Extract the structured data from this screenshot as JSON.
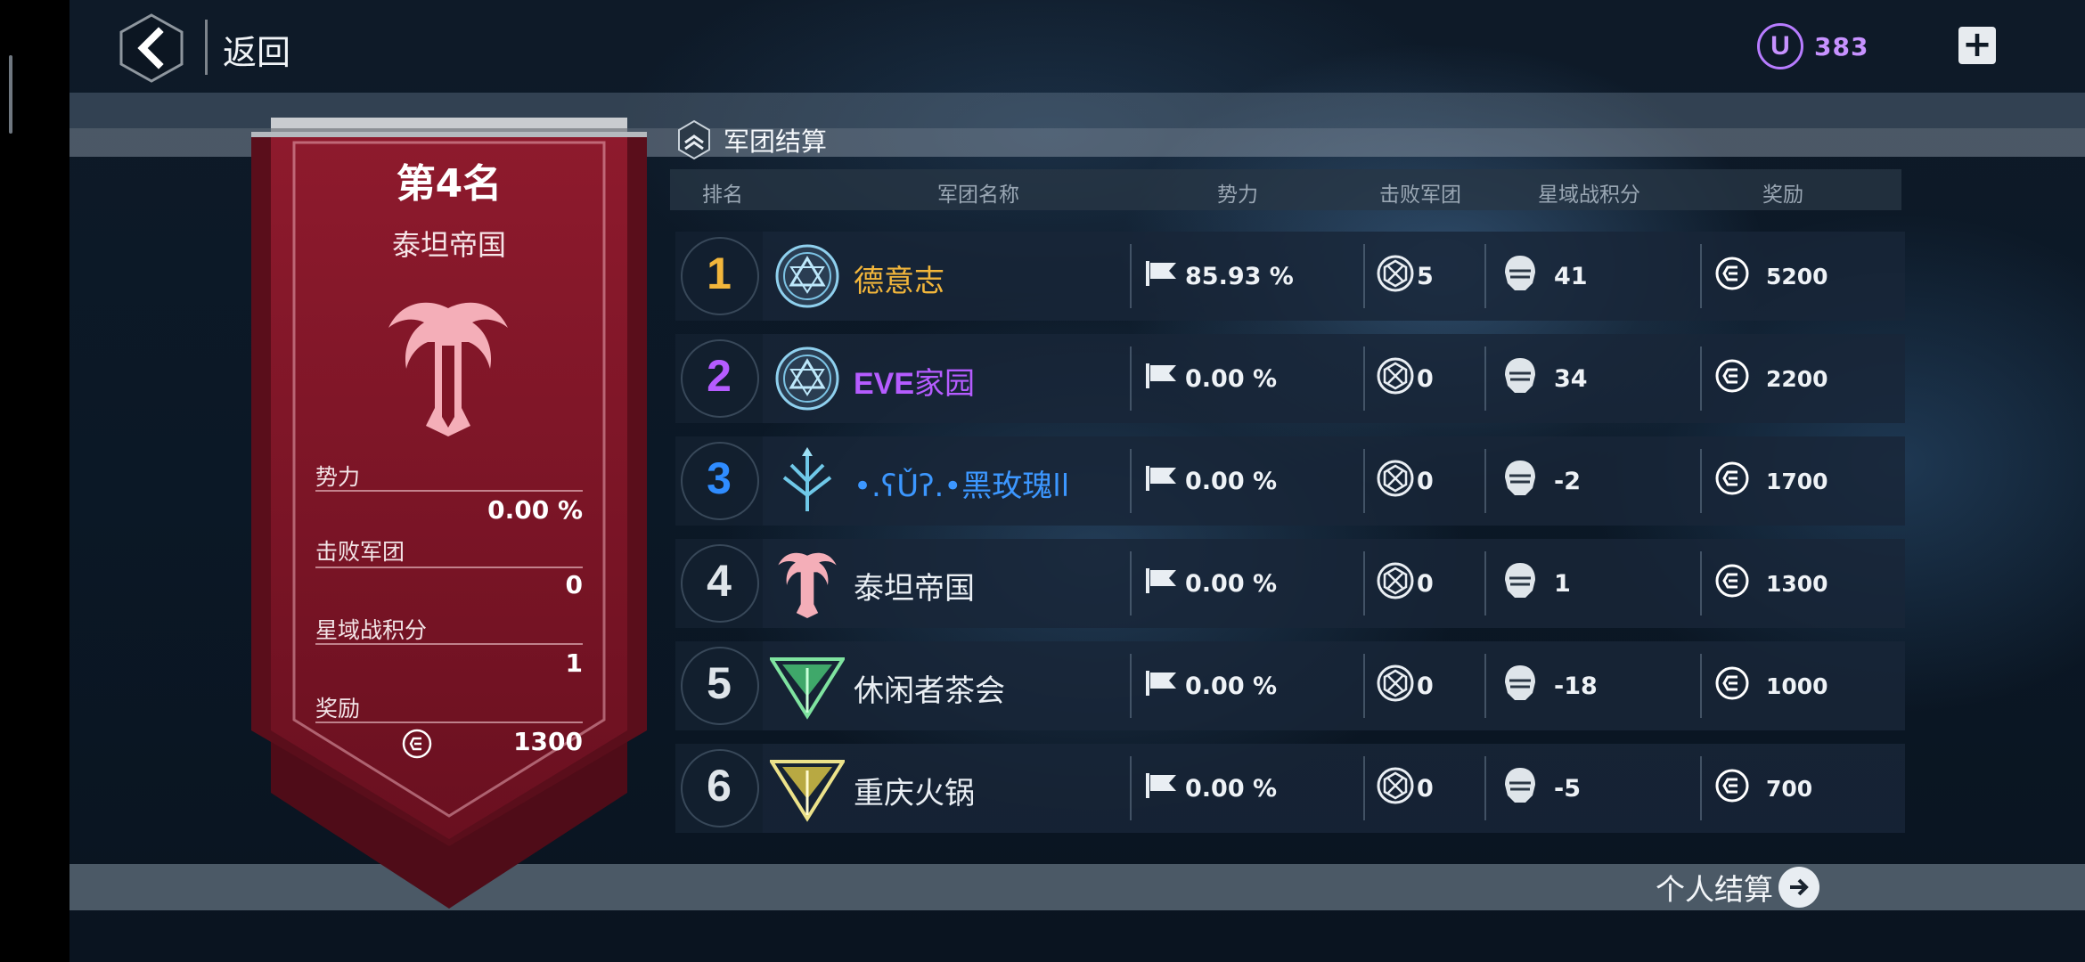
{
  "topbar": {
    "back_label": "返回",
    "currency_symbol": "U",
    "currency_amount": "383",
    "plus_label": "+"
  },
  "section": {
    "title": "军团结算"
  },
  "banner": {
    "rank_title": "第4名",
    "legion_name": "泰坦帝国",
    "stats": [
      {
        "label": "势力",
        "value": "0.00 %"
      },
      {
        "label": "击败军团",
        "value": "0"
      },
      {
        "label": "星域战积分",
        "value": "1"
      },
      {
        "label": "奖励",
        "value": "1300"
      }
    ]
  },
  "table": {
    "headers": [
      "排名",
      "军团名称",
      "势力",
      "击败军团",
      "星域战积分",
      "奖励"
    ],
    "rows": [
      {
        "rank": "1",
        "name": "德意志",
        "power": "85.93 %",
        "defeated": "5",
        "score": "41",
        "reward": "5200",
        "rank_color": "#f2b63b",
        "name_color": "#f2b63b",
        "emblem": "legion-emblem-circle"
      },
      {
        "rank": "2",
        "name": "EVE家园",
        "name_prefix": "EVE",
        "name_suffix": "家园",
        "power": "0.00 %",
        "defeated": "0",
        "score": "34",
        "reward": "2200",
        "rank_color": "#b55cff",
        "name_color": "#b55cff",
        "emblem": "legion-emblem-circle"
      },
      {
        "rank": "3",
        "name": "•˳ʕ̡̢̡ʘ̅͟͜͡ʘ̲̅ʔ̢̡̢˳•黑玫瑰ll",
        "name_display": "•.ʕǓʔ.•黑玫瑰ll",
        "power": "0.00 %",
        "defeated": "0",
        "score": "-2",
        "reward": "1700",
        "rank_color": "#2f8cff",
        "name_color": "#3c97ff",
        "emblem": "legion-emblem-trident"
      },
      {
        "rank": "4",
        "name": "泰坦帝国",
        "power": "0.00 %",
        "defeated": "0",
        "score": "1",
        "reward": "1300",
        "rank_color": "#dfe5ea",
        "name_color": "#e9eef3",
        "emblem": "legion-emblem-titan"
      },
      {
        "rank": "5",
        "name": "休闲者茶会",
        "power": "0.00 %",
        "defeated": "0",
        "score": "-18",
        "reward": "1000",
        "rank_color": "#dfe5ea",
        "name_color": "#e9eef3",
        "emblem": "legion-emblem-wing-green"
      },
      {
        "rank": "6",
        "name": "重庆火锅",
        "power": "0.00 %",
        "defeated": "0",
        "score": "-5",
        "reward": "700",
        "rank_color": "#dfe5ea",
        "name_color": "#e9eef3",
        "emblem": "legion-emblem-wing-yellow"
      }
    ]
  },
  "footer": {
    "personal_label": "个人结算"
  },
  "colors": {
    "banner_red": "#7f1526",
    "accent_purple": "#b77cff",
    "gold": "#f2b63b"
  }
}
